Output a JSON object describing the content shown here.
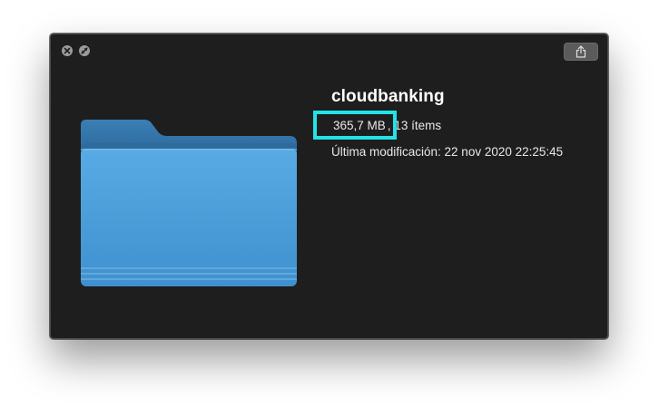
{
  "window": {
    "close_icon": "close-icon",
    "fullscreen_icon": "fullscreen-icon",
    "share_icon": "share-icon"
  },
  "file": {
    "name": "cloudbanking",
    "size": "365,7 MB",
    "separator": ", ",
    "items": "13 ítems",
    "modified": "Última modificación: 22 nov 2020 22:25:45",
    "icon": "folder-icon"
  },
  "colors": {
    "window_bg": "#1e1e1e",
    "folder_blue": "#4a9edb",
    "highlight": "#22e3e8"
  }
}
